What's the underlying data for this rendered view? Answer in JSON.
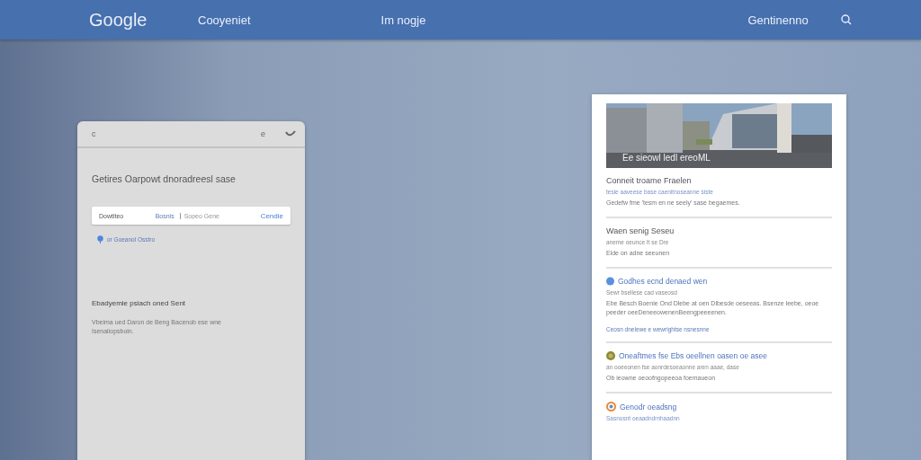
{
  "header": {
    "logo": "Google",
    "nav": [
      {
        "label": "Cooyeniet"
      },
      {
        "label": "Im nogje"
      },
      {
        "label": "Gentinenno"
      }
    ]
  },
  "left_panel": {
    "top_bar": {
      "left": "c",
      "right": "e"
    },
    "title": "Getires Oarpowt dnoradreesl sase",
    "search": {
      "label": "Dowtiteo",
      "value": "Bosnis",
      "placeholder": "Sopeo Gene",
      "action": "Cendie"
    },
    "location_link": "or Goeanol Osstro",
    "heading": "Ebadyemie psiach oned Sent",
    "paragraph": "Vbeima ued Daron de Beng Bacenob ese wne Isenaiiopsboin."
  },
  "right_card": {
    "image": {
      "kind": "picture",
      "caption": "Ee sieowl ledl ereoML"
    },
    "intro": {
      "title": "Conneit troame Fraelen",
      "link": "tesie aaveese base caenitnoseanne siste",
      "text": "Gedefw fme 'tesm en ne seely' sase begaemes."
    },
    "sections": [
      {
        "kind": "plain",
        "title": "Waen senig Seseu",
        "subtitle": "aneme oeunce It se Dre",
        "text": "Elde on adne seeunen"
      },
      {
        "kind": "dot",
        "title": "Godhes ecnd denaed wen",
        "subtitle": "Sewr bsellese cad vaseosd",
        "text": "Ebe Besch Boenie Ond Dlebe at oen Dlbesde oeseeas. Bsenze leebe, oeoe peeder oeeDeneeowenenBeengpeeeenen.",
        "link": "Ceosn dnelewe e wewrightse nsnesnne"
      },
      {
        "kind": "coin",
        "title": "Oneaftmes fse Ebs oeellnen oasen oe asee",
        "subtitle": "an ooeeonen fse aonrdesoeaonne aren aaae, dase",
        "text": "Ob ieowne oeoofngopeeoa foemaueon"
      },
      {
        "kind": "ring",
        "title": "Genodr oeadsng",
        "subtitle": "Sasnosnt oeaadndrnhaadnn"
      }
    ]
  }
}
